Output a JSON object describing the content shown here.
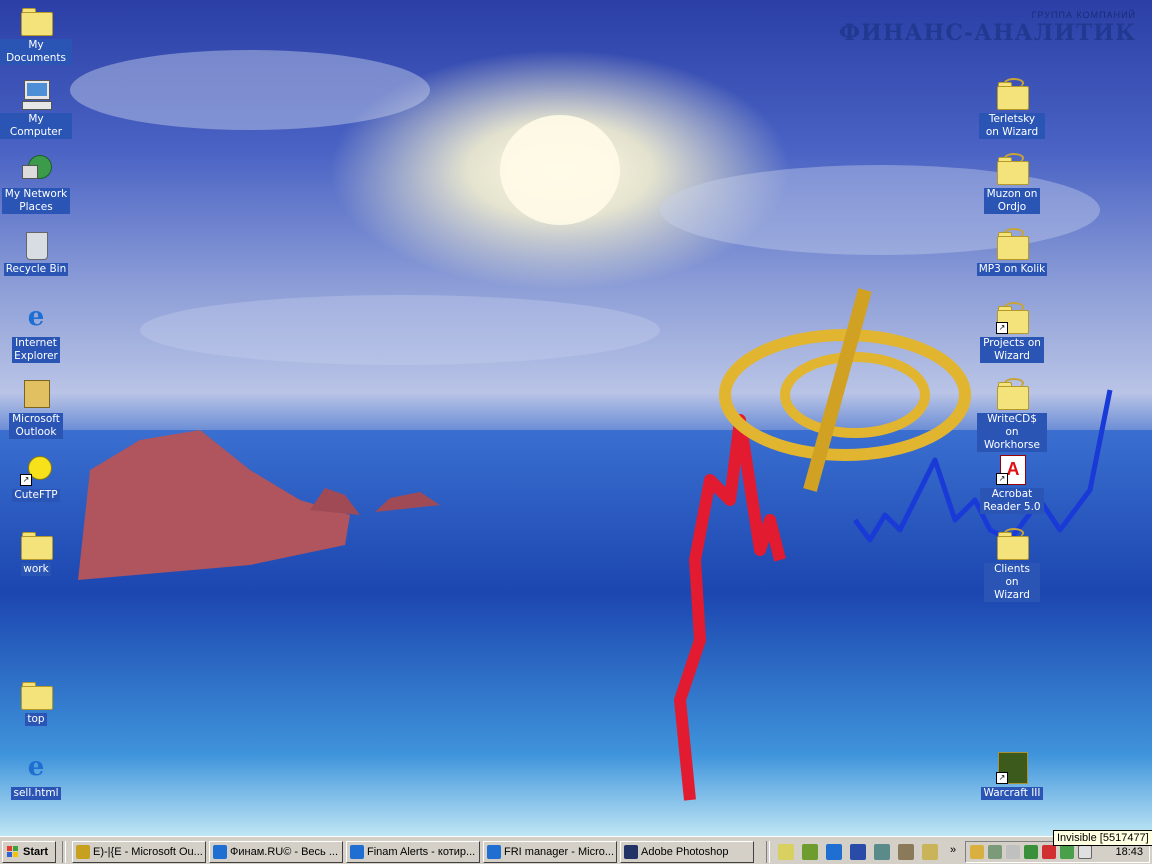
{
  "desktop": {
    "logo": {
      "top": "ГРУППА КОМПАНИЙ",
      "name": "ФИНАНС-АНАЛИТИК"
    },
    "left_icons": [
      {
        "label": "My Documents",
        "icon": "my-documents-icon"
      },
      {
        "label": "My Computer",
        "icon": "computer-icon"
      },
      {
        "label": "My Network Places",
        "icon": "network-icon"
      },
      {
        "label": "Recycle Bin",
        "icon": "recycle-bin-icon"
      },
      {
        "label": "Internet Explorer",
        "icon": "ie-icon"
      },
      {
        "label": "Microsoft Outlook",
        "icon": "outlook-icon"
      },
      {
        "label": "CuteFTP",
        "icon": "cuteftp-icon"
      },
      {
        "label": "work",
        "icon": "folder-icon"
      },
      {
        "label": "top",
        "icon": "folder-icon"
      },
      {
        "label": "sell.html",
        "icon": "ie-html-icon"
      }
    ],
    "right_icons": [
      {
        "label": "Terletsky on Wizard",
        "icon": "network-folder-icon"
      },
      {
        "label": "Muzon on Ordjo",
        "icon": "network-folder-icon"
      },
      {
        "label": "MP3 on Kolik",
        "icon": "network-folder-icon"
      },
      {
        "label": "Projects on Wizard",
        "icon": "network-folder-shortcut-icon"
      },
      {
        "label": "WriteCD$ on Workhorse",
        "icon": "network-folder-icon"
      },
      {
        "label": "Acrobat Reader 5.0",
        "icon": "acrobat-icon"
      },
      {
        "label": "Clients on Wizard",
        "icon": "network-folder-icon"
      },
      {
        "label": "Warcraft III",
        "icon": "warcraft-icon"
      }
    ]
  },
  "taskbar": {
    "start_label": "Start",
    "tasks": [
      {
        "label": "E)-|{E - Microsoft Ou...",
        "icon": "outlook-icon",
        "color": "#c8a020"
      },
      {
        "label": "Финам.RU© - Весь ...",
        "icon": "ie-icon",
        "color": "#1e6fd1"
      },
      {
        "label": "Finam Alerts - котир...",
        "icon": "ie-icon",
        "color": "#1e6fd1"
      },
      {
        "label": "FRI manager - Micro...",
        "icon": "ie-icon",
        "color": "#1e6fd1"
      },
      {
        "label": "Adobe Photoshop",
        "icon": "photoshop-icon",
        "color": "#223366"
      }
    ],
    "clock": "18:43"
  },
  "tooltip": "Invisible [5517477]",
  "colors": {
    "label_bg": "#2a55b5",
    "taskbar": "#d4d0c8"
  }
}
